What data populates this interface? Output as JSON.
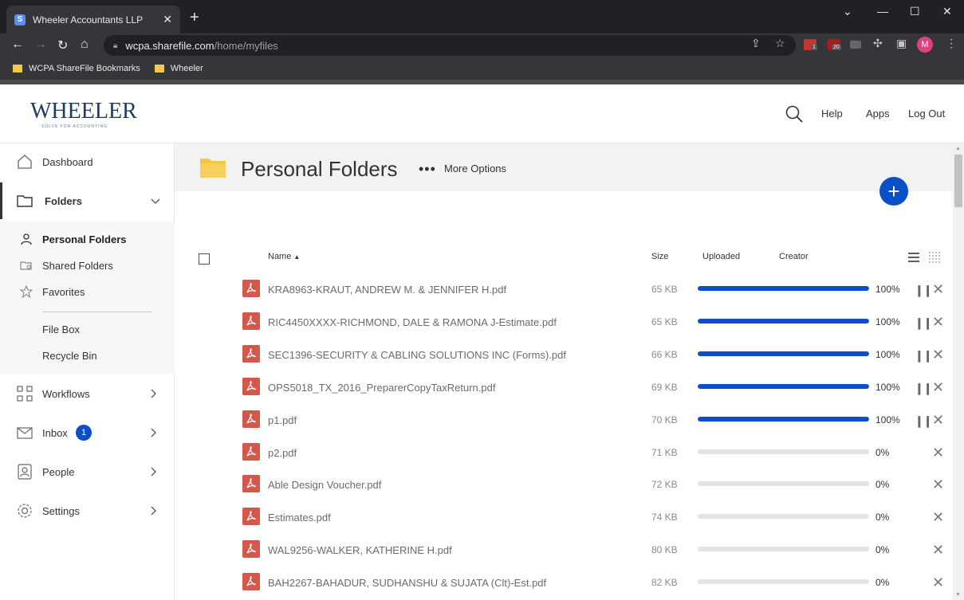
{
  "browser": {
    "tab_title": "Wheeler Accountants LLP",
    "tab_favicon": "S",
    "url_host": "wcpa.sharefile.com",
    "url_path": "/home/myfiles",
    "profile_initial": "M",
    "extensions": [
      {
        "name": "ext-red-icon",
        "badge": "1",
        "color": "#c0392b"
      },
      {
        "name": "ext-ub-icon",
        "badge": "20",
        "color": "#a61d1d"
      },
      {
        "name": "ext-grey-icon",
        "badge": "",
        "color": "#777"
      }
    ],
    "bookmarks": [
      "WCPA ShareFile Bookmarks",
      "Wheeler"
    ]
  },
  "header": {
    "logo_text": "WHEELER",
    "logo_tagline": "SOLVE FOR ACCOUNTING",
    "help": "Help",
    "apps": "Apps",
    "logout": "Log Out"
  },
  "sidebar": {
    "dashboard": "Dashboard",
    "folders": "Folders",
    "personal_folders": "Personal Folders",
    "shared_folders": "Shared Folders",
    "favorites": "Favorites",
    "file_box": "File Box",
    "recycle_bin": "Recycle Bin",
    "workflows": "Workflows",
    "inbox": "Inbox",
    "inbox_count": "1",
    "people": "People",
    "settings": "Settings"
  },
  "main": {
    "title": "Personal Folders",
    "more_options": "More Options",
    "columns": {
      "name": "Name",
      "size": "Size",
      "uploaded": "Uploaded",
      "creator": "Creator"
    },
    "files": [
      {
        "name": "KRA8963-KRAUT, ANDREW M. & JENNIFER H.pdf",
        "size": "65 KB",
        "progress": 100,
        "pct": "100%",
        "paused_control": true
      },
      {
        "name": "RIC4450XXXX-RICHMOND, DALE & RAMONA J-Estimate.pdf",
        "size": "65 KB",
        "progress": 100,
        "pct": "100%",
        "paused_control": true
      },
      {
        "name": "SEC1396-SECURITY & CABLING SOLUTIONS INC (Forms).pdf",
        "size": "66 KB",
        "progress": 100,
        "pct": "100%",
        "paused_control": true
      },
      {
        "name": "OPS5018_TX_2016_PreparerCopyTaxReturn.pdf",
        "size": "69 KB",
        "progress": 100,
        "pct": "100%",
        "paused_control": true
      },
      {
        "name": "p1.pdf",
        "size": "70 KB",
        "progress": 100,
        "pct": "100%",
        "paused_control": true
      },
      {
        "name": "p2.pdf",
        "size": "71 KB",
        "progress": 0,
        "pct": "0%",
        "paused_control": false
      },
      {
        "name": "Able Design Voucher.pdf",
        "size": "72 KB",
        "progress": 0,
        "pct": "0%",
        "paused_control": false
      },
      {
        "name": "Estimates.pdf",
        "size": "74 KB",
        "progress": 0,
        "pct": "0%",
        "paused_control": false
      },
      {
        "name": "WAL9256-WALKER, KATHERINE H.pdf",
        "size": "80 KB",
        "progress": 0,
        "pct": "0%",
        "paused_control": false
      },
      {
        "name": "BAH2267-BAHADUR, SUDHANSHU & SUJATA (Clt)-Est.pdf",
        "size": "82 KB",
        "progress": 0,
        "pct": "0%",
        "paused_control": false
      }
    ]
  },
  "colors": {
    "accent": "#0b4fc8",
    "pdf": "#d4574c",
    "folder": "#f5c542"
  }
}
